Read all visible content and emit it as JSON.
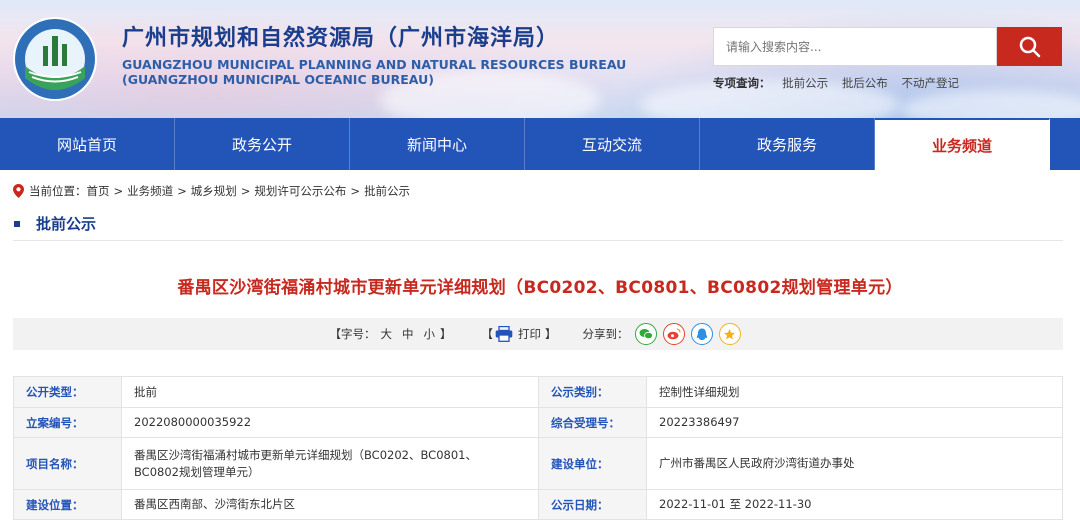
{
  "header": {
    "title_cn": "广州市规划和自然资源局（广州市海洋局）",
    "title_en_1": "GUANGZHOU MUNICIPAL PLANNING AND NATURAL RESOURCES BUREAU",
    "title_en_2": "(GUANGZHOU MUNICIPAL OCEANIC BUREAU)",
    "logo_text": "广州市规划和自然资源局",
    "search_placeholder": "请输入搜索内容...",
    "quick_label": "专项查询：",
    "quick_links": [
      "批前公示",
      "批后公布",
      "不动产登记"
    ]
  },
  "nav": {
    "items": [
      "网站首页",
      "政务公开",
      "新闻中心",
      "互动交流",
      "政务服务",
      "业务频道"
    ],
    "active_index": 5
  },
  "breadcrumb": {
    "label": "当前位置：",
    "items": [
      "首页",
      "业务频道",
      "城乡规划",
      "规划许可公示公布",
      "批前公示"
    ],
    "separator": ">"
  },
  "section": {
    "title": "批前公示"
  },
  "article": {
    "title": "番禺区沙湾街福涌村城市更新单元详细规划（BC0202、BC0801、BC0802规划管理单元）"
  },
  "toolbar": {
    "font_open": "【字号：",
    "font_large": "大",
    "font_medium": "中",
    "font_small": "小",
    "font_close": "】",
    "print_open": "【",
    "print_label": "打印",
    "print_close": "】",
    "share_label": "分享到："
  },
  "info": {
    "rows": [
      {
        "l1": "公开类型：",
        "v1": "批前",
        "l2": "公示类别：",
        "v2": "控制性详细规划"
      },
      {
        "l1": "立案编号：",
        "v1": "2022080000035922",
        "l2": "综合受理号：",
        "v2": "20223386497"
      },
      {
        "l1": "项目名称：",
        "v1": "番禺区沙湾街福涌村城市更新单元详细规划（BC0202、BC0801、BC0802规划管理单元）",
        "l2": "建设单位：",
        "v2": "广州市番禺区人民政府沙湾街道办事处"
      },
      {
        "l1": "建设位置：",
        "v1": "番禺区西南部、沙湾街东北片区",
        "l2": "公示日期：",
        "v2": "2022-11-01 至 2022-11-30"
      }
    ]
  },
  "colors": {
    "brand_blue": "#2354b8",
    "title_red": "#c8291f",
    "label_blue": "#2354b8"
  }
}
